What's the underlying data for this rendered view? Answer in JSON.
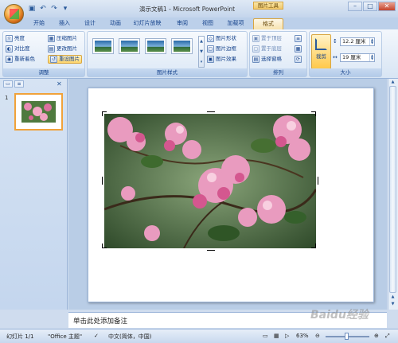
{
  "window": {
    "title": "演示文稿1 - Microsoft PowerPoint",
    "tool_tab": "图片工具",
    "controls": [
      "–",
      "□",
      "✕"
    ]
  },
  "ribbon_tabs": [
    "开始",
    "插入",
    "设计",
    "动画",
    "幻灯片放映",
    "审阅",
    "视图",
    "加载项",
    "格式"
  ],
  "active_tab": "格式",
  "ribbon": {
    "adjust": {
      "label": "调整",
      "brightness": "亮度",
      "contrast": "对比度",
      "recolor": "重新着色",
      "compress": "压缩图片",
      "change": "更改图片",
      "reset": "重设图片"
    },
    "styles": {
      "label": "图片样式",
      "shape": "图片形状",
      "border": "图片边框",
      "effects": "图片效果"
    },
    "arrange": {
      "label": "排列",
      "bring_front": "置于顶层",
      "send_back": "置于底层",
      "selection_pane": "选择窗格"
    },
    "size": {
      "label": "大小",
      "crop": "裁剪",
      "height": "12.2 厘米",
      "width": "19 厘米"
    }
  },
  "slides_panel": {
    "slide_number": "1"
  },
  "notes": {
    "placeholder": "单击此处添加备注"
  },
  "statusbar": {
    "slide_info": "幻灯片 1/1",
    "theme": "\"Office 主题\"",
    "language": "中文(简体，中国)",
    "zoom": "63%"
  },
  "watermark": "Baidu经验",
  "colors": {
    "accent": "#f1c86a",
    "ribbon_bg": "#dce8f6",
    "selection": "#f0a23a"
  }
}
